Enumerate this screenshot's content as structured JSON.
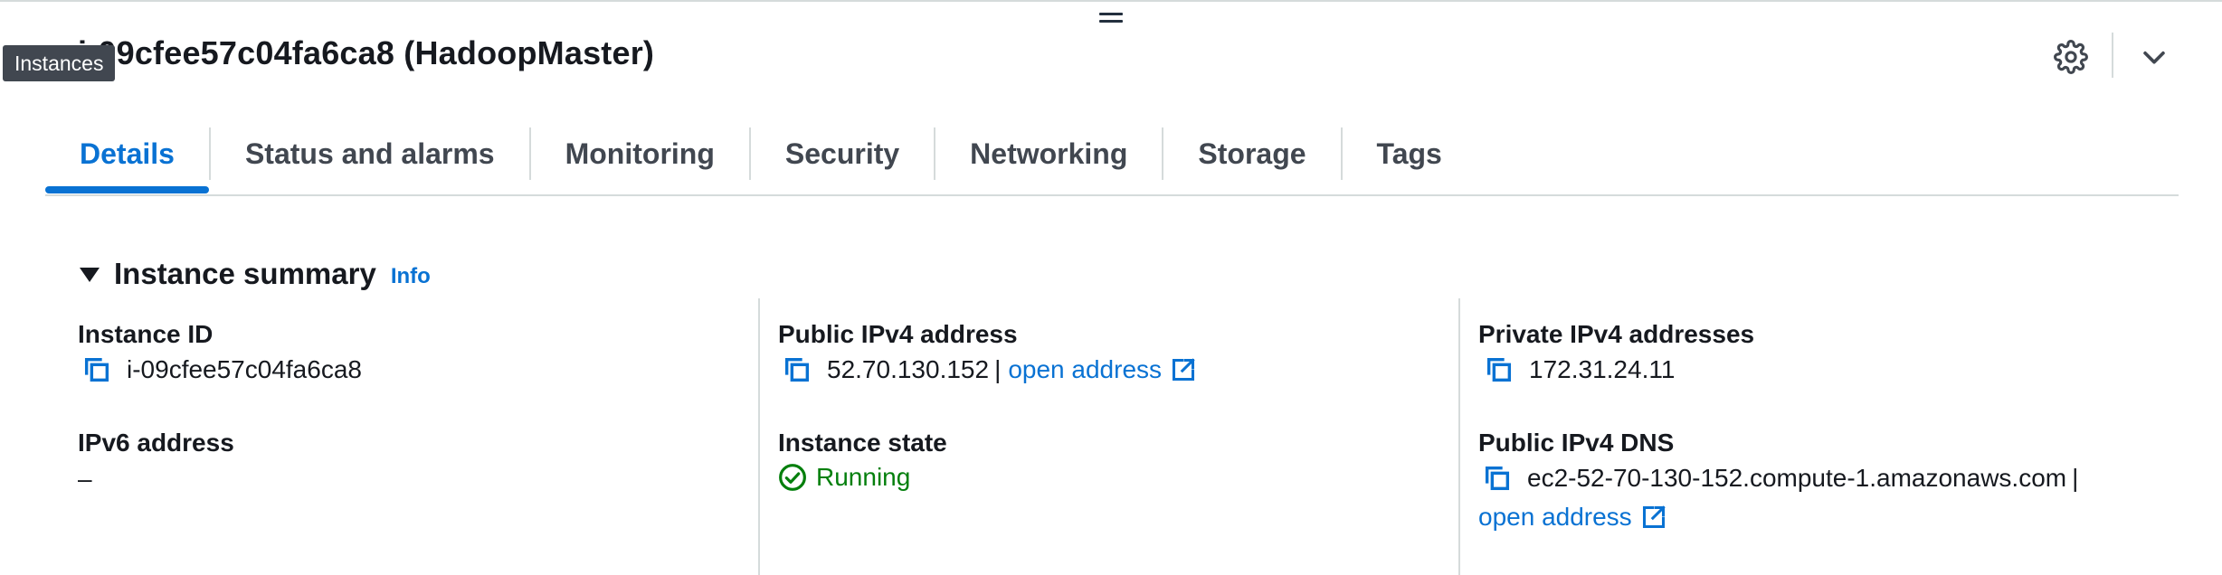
{
  "header": {
    "title": "i-09cfee57c04fa6ca8 (HadoopMaster)",
    "tooltip": "Instances",
    "settings_icon": "gear-icon",
    "collapse_icon": "chevron-down-icon"
  },
  "tabs": [
    {
      "label": "Details",
      "active": true
    },
    {
      "label": "Status and alarms",
      "active": false
    },
    {
      "label": "Monitoring",
      "active": false
    },
    {
      "label": "Security",
      "active": false
    },
    {
      "label": "Networking",
      "active": false
    },
    {
      "label": "Storage",
      "active": false
    },
    {
      "label": "Tags",
      "active": false
    }
  ],
  "summary": {
    "title": "Instance summary",
    "info_label": "Info",
    "instance_id": {
      "label": "Instance ID",
      "value": "i-09cfee57c04fa6ca8"
    },
    "ipv6": {
      "label": "IPv6 address",
      "value": "–"
    },
    "public_ipv4": {
      "label": "Public IPv4 address",
      "value": "52.70.130.152",
      "separator": "|",
      "link": "open address"
    },
    "instance_state": {
      "label": "Instance state",
      "value": "Running"
    },
    "private_ipv4": {
      "label": "Private IPv4 addresses",
      "value": "172.31.24.11"
    },
    "public_dns": {
      "label": "Public IPv4 DNS",
      "value": "ec2-52-70-130-152.compute-1.amazonaws.com",
      "separator": "|",
      "link": "open address"
    }
  },
  "colors": {
    "accent": "#0972d3",
    "success": "#037f0c",
    "text": "#16191f",
    "divider": "#d5dbdb"
  }
}
